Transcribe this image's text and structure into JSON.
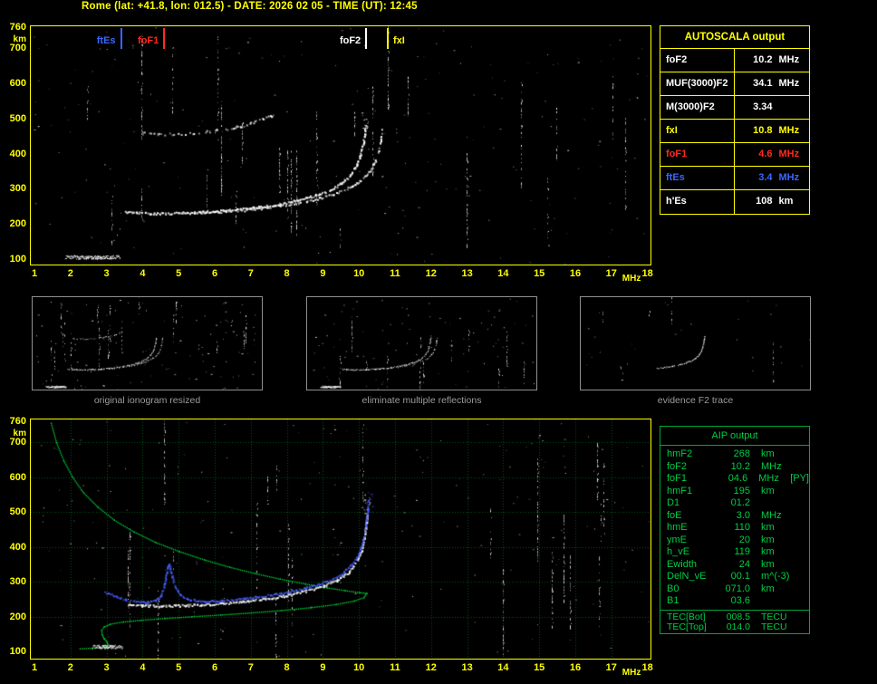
{
  "title": "Rome (lat: +41.8, lon: 012.5) - DATE: 2026 02 05 - TIME (UT): 12:45",
  "colors": {
    "yellow": "#ffff00",
    "red": "#ff2b20",
    "blue": "#3a66ff",
    "white": "#ffffff",
    "green": "#00d435",
    "green_border": "#00a838",
    "grid": "rgba(0,145,35,0.6)",
    "gray": "#9c9c9c"
  },
  "axes": {
    "y_unit": "km",
    "x_unit": "MHz",
    "km_ticks": [
      760,
      700,
      600,
      500,
      400,
      300,
      200,
      100
    ],
    "mhz_ticks": [
      1,
      2,
      3,
      4,
      5,
      6,
      7,
      8,
      9,
      10,
      11,
      12,
      13,
      14,
      15,
      16,
      17,
      18
    ]
  },
  "top_plot": {
    "markers": [
      {
        "label": "ftEs",
        "freq": 3.4,
        "color": "blue",
        "side": "left"
      },
      {
        "label": "foF1",
        "freq": 4.6,
        "color": "red",
        "side": "left"
      },
      {
        "label": "foF2",
        "freq": 10.2,
        "color": "white",
        "side": "left"
      },
      {
        "label": "fxI",
        "freq": 10.8,
        "color": "yellow",
        "side": "right"
      }
    ],
    "traces": {
      "e_layer": {
        "f1": 1.85,
        "f2": 3.38,
        "km": 106
      },
      "f_o_mode": [
        [
          3.5,
          236
        ],
        [
          3.8,
          233
        ],
        [
          4.2,
          231
        ],
        [
          4.8,
          232
        ],
        [
          5.4,
          234
        ],
        [
          6.0,
          237
        ],
        [
          6.6,
          242
        ],
        [
          7.2,
          249
        ],
        [
          7.8,
          258
        ],
        [
          8.3,
          269
        ],
        [
          8.8,
          283
        ],
        [
          9.2,
          299
        ],
        [
          9.5,
          317
        ],
        [
          9.75,
          340
        ],
        [
          9.92,
          367
        ],
        [
          10.03,
          398
        ],
        [
          10.1,
          428
        ],
        [
          10.14,
          455
        ],
        [
          10.17,
          478
        ]
      ],
      "f_x_mode": [
        [
          5.2,
          232
        ],
        [
          6.0,
          235
        ],
        [
          6.8,
          241
        ],
        [
          7.6,
          250
        ],
        [
          8.3,
          261
        ],
        [
          8.9,
          275
        ],
        [
          9.4,
          291
        ],
        [
          9.8,
          309
        ],
        [
          10.1,
          330
        ],
        [
          10.32,
          355
        ],
        [
          10.45,
          382
        ],
        [
          10.54,
          412
        ],
        [
          10.6,
          442
        ],
        [
          10.63,
          468
        ]
      ],
      "second_hop": [
        [
          3.9,
          461
        ],
        [
          4.4,
          458
        ],
        [
          5.0,
          458
        ],
        [
          5.6,
          462
        ],
        [
          6.1,
          468
        ],
        [
          6.6,
          477
        ],
        [
          7.0,
          488
        ],
        [
          7.35,
          500
        ],
        [
          7.6,
          512
        ]
      ]
    }
  },
  "autoscala": {
    "title": "AUTOSCALA output",
    "rows": [
      {
        "param": "foF2",
        "value": "10.2",
        "unit": "MHz",
        "color": "white"
      },
      {
        "param": "MUF(3000)F2",
        "value": "34.1",
        "unit": "MHz",
        "color": "white"
      },
      {
        "param": "M(3000)F2",
        "value": "3.34",
        "unit": "",
        "color": "white"
      },
      {
        "param": "fxI",
        "value": "10.8",
        "unit": "MHz",
        "color": "yellow"
      },
      {
        "param": "foF1",
        "value": "4.6",
        "unit": "MHz",
        "color": "red"
      },
      {
        "param": "ftEs",
        "value": "3.4",
        "unit": "MHz",
        "color": "blue"
      },
      {
        "param": "h'Es",
        "value": "108",
        "unit": "km",
        "color": "white"
      }
    ]
  },
  "thumbnails": {
    "items": [
      {
        "caption": "original ionogram resized"
      },
      {
        "caption": "eliminate multiple reflections"
      },
      {
        "caption": "evidence F2 trace"
      }
    ]
  },
  "bottom_plot": {
    "profile": [
      [
        1.45,
        756
      ],
      [
        1.6,
        700
      ],
      [
        1.8,
        648
      ],
      [
        2.05,
        600
      ],
      [
        2.35,
        556
      ],
      [
        2.75,
        515
      ],
      [
        3.2,
        478
      ],
      [
        3.75,
        444
      ],
      [
        4.35,
        414
      ],
      [
        5.0,
        388
      ],
      [
        5.7,
        364
      ],
      [
        6.4,
        343
      ],
      [
        7.1,
        325
      ],
      [
        7.8,
        309
      ],
      [
        8.5,
        295
      ],
      [
        9.1,
        284
      ],
      [
        9.6,
        276
      ],
      [
        10.0,
        270
      ],
      [
        10.2,
        268
      ],
      [
        10.12,
        256
      ],
      [
        9.85,
        246
      ],
      [
        9.35,
        236
      ],
      [
        8.65,
        227
      ],
      [
        7.85,
        219
      ],
      [
        7.0,
        212
      ],
      [
        6.15,
        206
      ],
      [
        5.35,
        201
      ],
      [
        4.6,
        196
      ],
      [
        3.95,
        191
      ],
      [
        3.45,
        186
      ],
      [
        3.1,
        180
      ],
      [
        2.92,
        172
      ],
      [
        2.85,
        162
      ],
      [
        2.86,
        150
      ],
      [
        2.92,
        138
      ],
      [
        3.0,
        128
      ],
      [
        3.02,
        120
      ],
      [
        2.9,
        114
      ],
      [
        2.6,
        111
      ],
      [
        2.25,
        109
      ]
    ],
    "white_trace": [
      [
        3.6,
        236
      ],
      [
        4.0,
        233
      ],
      [
        4.5,
        231
      ],
      [
        5.0,
        233
      ],
      [
        5.6,
        235
      ],
      [
        6.2,
        239
      ],
      [
        6.8,
        245
      ],
      [
        7.4,
        252
      ],
      [
        8.0,
        262
      ],
      [
        8.5,
        274
      ],
      [
        9.0,
        289
      ],
      [
        9.4,
        307
      ],
      [
        9.7,
        329
      ],
      [
        9.9,
        355
      ],
      [
        10.05,
        389
      ],
      [
        10.13,
        424
      ],
      [
        10.18,
        460
      ],
      [
        10.21,
        495
      ]
    ],
    "blue_trace": [
      [
        2.95,
        271
      ],
      [
        3.2,
        261
      ],
      [
        3.5,
        251
      ],
      [
        3.8,
        245
      ],
      [
        4.1,
        242
      ],
      [
        4.35,
        247
      ],
      [
        4.5,
        261
      ],
      [
        4.6,
        298
      ],
      [
        4.68,
        345
      ],
      [
        4.72,
        352
      ],
      [
        4.78,
        328
      ],
      [
        4.88,
        288
      ],
      [
        5.05,
        261
      ],
      [
        5.3,
        250
      ],
      [
        5.7,
        245
      ],
      [
        6.2,
        247
      ],
      [
        6.8,
        253
      ],
      [
        7.4,
        261
      ],
      [
        8.0,
        271
      ],
      [
        8.6,
        286
      ],
      [
        9.1,
        303
      ],
      [
        9.5,
        324
      ],
      [
        9.8,
        351
      ],
      [
        10.0,
        384
      ],
      [
        10.1,
        419
      ],
      [
        10.17,
        458
      ],
      [
        10.22,
        498
      ],
      [
        10.26,
        535
      ]
    ],
    "e_layer_white": {
      "f1": 2.6,
      "f2": 3.45,
      "km": 114
    }
  },
  "aip": {
    "title": "AIP output",
    "rows": [
      {
        "param": "hmF2",
        "value": "268",
        "unit": "km",
        "note": ""
      },
      {
        "param": "foF2",
        "value": "10.2",
        "unit": "MHz",
        "note": ""
      },
      {
        "param": "foF1",
        "value": "04.6",
        "unit": "MHz",
        "note": "[PY]"
      },
      {
        "param": "hmF1",
        "value": "195",
        "unit": "km",
        "note": ""
      },
      {
        "param": "D1",
        "value": "01.2",
        "unit": "",
        "note": ""
      },
      {
        "param": "foE",
        "value": "3.0",
        "unit": "MHz",
        "note": ""
      },
      {
        "param": "hmE",
        "value": "110",
        "unit": "km",
        "note": ""
      },
      {
        "param": "ymE",
        "value": "20",
        "unit": "km",
        "note": ""
      },
      {
        "param": "h_vE",
        "value": "119",
        "unit": "km",
        "note": ""
      },
      {
        "param": "Ewidth",
        "value": "24",
        "unit": "km",
        "note": ""
      },
      {
        "param": "DelN_vE",
        "value": "00.1",
        "unit": "m^(-3)",
        "note": ""
      },
      {
        "param": "B0",
        "value": "071.0",
        "unit": "km",
        "note": ""
      },
      {
        "param": "B1",
        "value": "03.6",
        "unit": "",
        "note": ""
      }
    ],
    "tec_rows": [
      {
        "param": "TEC[Bot]",
        "value": "008.5",
        "unit": "TECU"
      },
      {
        "param": "TEC[Top]",
        "value": "014.0",
        "unit": "TECU"
      }
    ]
  }
}
